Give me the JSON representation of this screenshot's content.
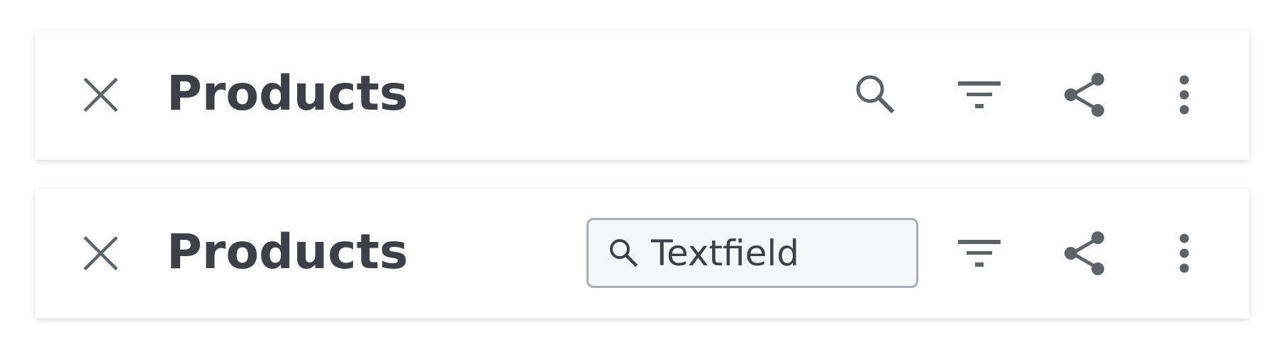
{
  "toolbars": [
    {
      "title": "Products",
      "icons": [
        "close-icon",
        "search-icon",
        "filter-icon",
        "share-icon",
        "more-vert-icon"
      ]
    },
    {
      "title": "Products",
      "search": {
        "value": "Textfield"
      },
      "icons": [
        "close-icon",
        "search-icon",
        "filter-icon",
        "share-icon",
        "more-vert-icon"
      ]
    }
  ],
  "colors": {
    "icon": "#5e6269",
    "text": "#3d4048",
    "field_border": "#a9aeb5",
    "field_background": "#f5f6f8",
    "surface": "#ffffff"
  }
}
